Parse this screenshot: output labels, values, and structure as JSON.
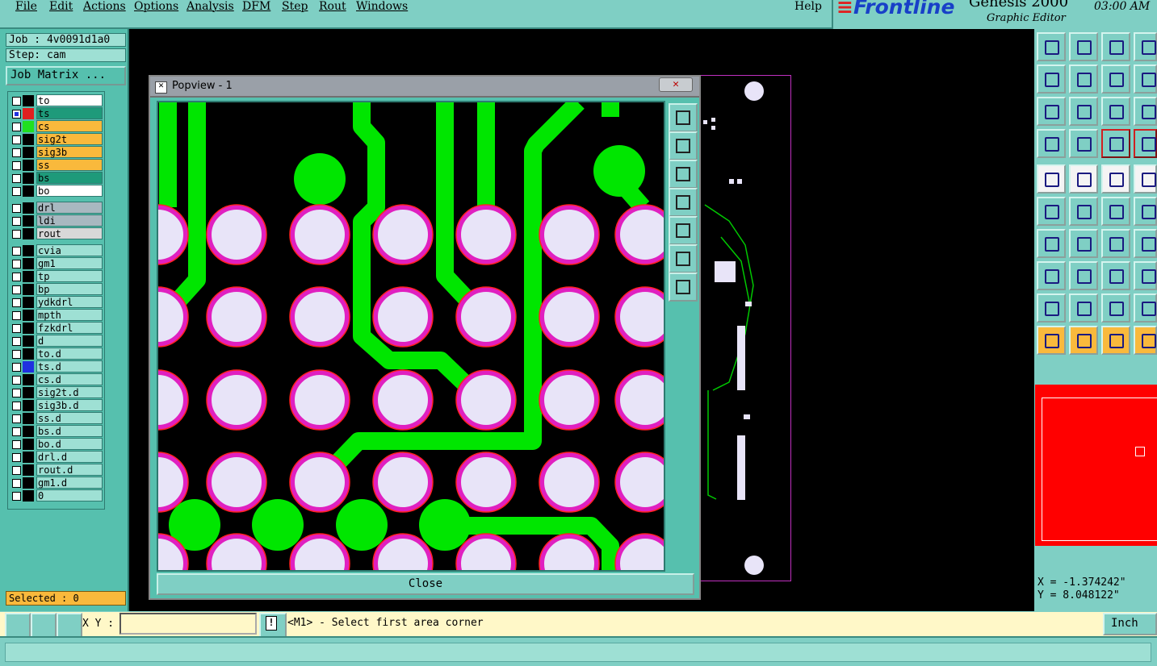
{
  "menu": [
    "File",
    "Edit",
    "Actions",
    "Options",
    "Analysis",
    "DFM",
    "Step",
    "Rout",
    "Windows"
  ],
  "help": "Help",
  "brand": {
    "logo": "Frontline",
    "product": "Genesis 2000",
    "subtitle": "Graphic Editor"
  },
  "clock": "03:00 AM",
  "job": "Job : 4v0091d1a0",
  "step": "Step: cam",
  "job_matrix": "Job Matrix ...",
  "layers": [
    {
      "name": "to",
      "fill": "#ffffff",
      "swatch": "#000000"
    },
    {
      "name": "ts",
      "fill": "#1e9a7a",
      "swatch": "#e02020",
      "active": true
    },
    {
      "name": "cs",
      "fill": "#f9b93c",
      "swatch": "#20e020"
    },
    {
      "name": "sig2t",
      "fill": "#f9b93c",
      "swatch": "#000000"
    },
    {
      "name": "sig3b",
      "fill": "#f9b93c",
      "swatch": "#000000"
    },
    {
      "name": "ss",
      "fill": "#f9b93c",
      "swatch": "#000000"
    },
    {
      "name": "bs",
      "fill": "#1e9a7a",
      "swatch": "#000000"
    },
    {
      "name": "bo",
      "fill": "#ffffff",
      "swatch": "#000000"
    },
    {
      "name": "drl",
      "fill": "#a8b8c0",
      "swatch": "#000000",
      "gap": true
    },
    {
      "name": "ldi",
      "fill": "#a8b8c0",
      "swatch": "#000000"
    },
    {
      "name": "rout",
      "fill": "#d8d8d8",
      "swatch": "#000000"
    },
    {
      "name": "cvia",
      "fill": "#9ee0d4",
      "swatch": "#000000",
      "gap": true
    },
    {
      "name": "gm1",
      "fill": "#9ee0d4",
      "swatch": "#000000"
    },
    {
      "name": "tp",
      "fill": "#9ee0d4",
      "swatch": "#000000"
    },
    {
      "name": "bp",
      "fill": "#9ee0d4",
      "swatch": "#000000"
    },
    {
      "name": "ydkdrl",
      "fill": "#9ee0d4",
      "swatch": "#000000"
    },
    {
      "name": "mpth",
      "fill": "#9ee0d4",
      "swatch": "#000000"
    },
    {
      "name": "fzkdrl",
      "fill": "#9ee0d4",
      "swatch": "#000000"
    },
    {
      "name": "d",
      "fill": "#9ee0d4",
      "swatch": "#000000"
    },
    {
      "name": "to.d",
      "fill": "#9ee0d4",
      "swatch": "#000000"
    },
    {
      "name": "ts.d",
      "fill": "#9ee0d4",
      "swatch": "#2030e0"
    },
    {
      "name": "cs.d",
      "fill": "#9ee0d4",
      "swatch": "#000000"
    },
    {
      "name": "sig2t.d",
      "fill": "#9ee0d4",
      "swatch": "#000000"
    },
    {
      "name": "sig3b.d",
      "fill": "#9ee0d4",
      "swatch": "#000000"
    },
    {
      "name": "ss.d",
      "fill": "#9ee0d4",
      "swatch": "#000000"
    },
    {
      "name": "bs.d",
      "fill": "#9ee0d4",
      "swatch": "#000000"
    },
    {
      "name": "bo.d",
      "fill": "#9ee0d4",
      "swatch": "#000000"
    },
    {
      "name": "drl.d",
      "fill": "#9ee0d4",
      "swatch": "#000000"
    },
    {
      "name": "rout.d",
      "fill": "#9ee0d4",
      "swatch": "#000000"
    },
    {
      "name": "gm1.d",
      "fill": "#9ee0d4",
      "swatch": "#000000"
    },
    {
      "name": "0",
      "fill": "#9ee0d4",
      "swatch": "#000000"
    }
  ],
  "selected": "Selected : 0",
  "popup": {
    "title": "Popview - 1",
    "close": "Close"
  },
  "popup_tools": [
    "zoom-window-icon",
    "pan-up-icon",
    "pan-down-icon",
    "pan-left-icon",
    "pan-right-icon",
    "zoom-fit-icon",
    "zoom-home-icon"
  ],
  "right_tools": [
    [
      "pan-up-icon",
      "pan-down-icon",
      "home-icon",
      "zoom-box-icon"
    ],
    [
      "pan-left-icon",
      "pan-right-icon",
      "redraw-icon",
      "step-icon"
    ],
    [
      "zoom-fit-icon",
      "zoom-center-icon",
      "scale-1-2-icon",
      "query-icon"
    ],
    [
      "measure-tool-icon",
      "grid-icon",
      "snap-icon",
      "snap-alt-icon"
    ],
    [
      "add-pad-icon",
      "add-line-icon",
      "ruler-icon",
      "pad-icon"
    ],
    [
      "connect-icon",
      "cut-icon",
      "move-icon",
      "move-alt-icon"
    ],
    [
      "line-icon",
      "slope-icon",
      "arc-icon",
      "text-icon"
    ],
    [
      "copy-pad-icon",
      "dash-icon",
      "distance-icon",
      "group-icon"
    ],
    [
      "outline-icon",
      "arrow-up-icon",
      "arrow-up-alt-icon",
      "arrow-up-extra-icon"
    ],
    [
      "select-arrow-icon",
      "select-box-icon",
      "select-circle-icon",
      "select-net-icon"
    ]
  ],
  "coords": {
    "x": "X = -1.374242\"",
    "y": "Y = 8.048122\""
  },
  "xy_label": "X Y :",
  "xy_value": "",
  "message": "<M1> - Select first area corner",
  "units": "Inch",
  "colors": {
    "panel": "#56c0ae",
    "menu": "#7fcfc4",
    "trace": "#00e600",
    "pad_fill": "#e8e4f8",
    "pad_ring": "#e020c0",
    "minimap": "#ff0000"
  }
}
